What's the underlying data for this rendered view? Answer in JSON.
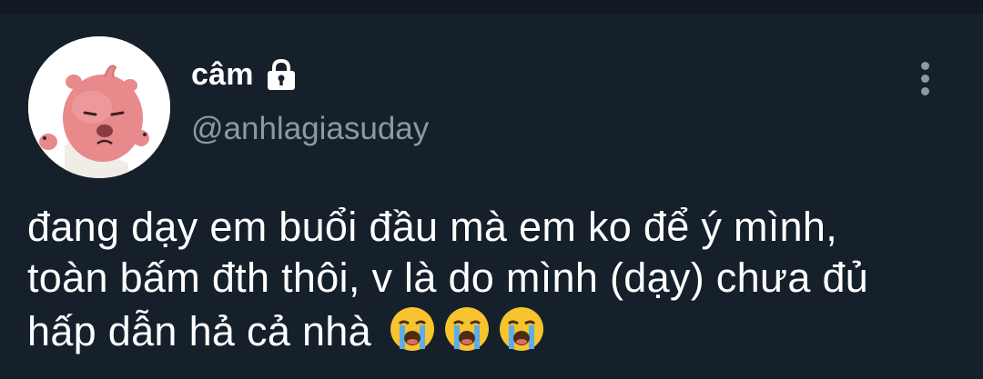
{
  "author": {
    "display_name": "câm",
    "handle": "@anhlagiasuday",
    "protected_icon": "lock-icon",
    "avatar": "pink-cartoon-avatar"
  },
  "menu_icon": "more-vertical-icon",
  "tweet": {
    "lines": [
      "đang dạy em buổi đầu mà em ko để ý mình,",
      "toàn bấm đth thôi, v là do mình (dạy) chưa đủ",
      "hấp dẫn hả cả nhà"
    ],
    "emoji": [
      "😭",
      "😭",
      "😭"
    ],
    "emoji_name": "loudly-crying-face"
  },
  "colors": {
    "background": "#15202b",
    "text": "#ffffff",
    "secondary": "#8b98a5"
  }
}
